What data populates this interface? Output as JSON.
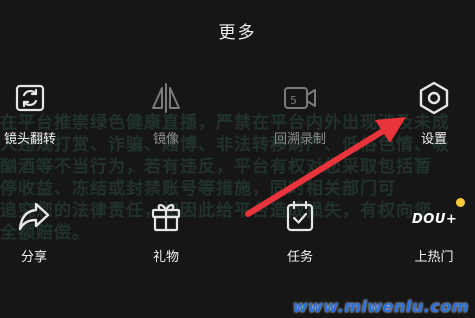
{
  "sheet": {
    "title": "更多"
  },
  "background_notice": {
    "lines": [
      "在平台推崇绿色健康直播，严禁在平台内外出现涉及未成",
      "人违规打赏、诈骗、赌博、非法转移财产、低俗色情、吸",
      "酗酒等不当行为，若有违反，平台有权对您采取包括暂",
      "停收益、冻结或封禁账号等措施，同时相关部门可",
      "追究您的法律责任，如因此给平台造成损失，有权向您",
      "全额赔偿。"
    ]
  },
  "row1": [
    {
      "label": "镜头翻转",
      "icon": "camera-flip-icon"
    },
    {
      "label": "镜像",
      "icon": "mirror-icon"
    },
    {
      "label": "回溯录制",
      "icon": "replay-record-icon"
    },
    {
      "label": "设置",
      "icon": "settings-icon"
    }
  ],
  "row2": [
    {
      "label": "分享",
      "icon": "share-icon"
    },
    {
      "label": "礼物",
      "icon": "gift-icon"
    },
    {
      "label": "任务",
      "icon": "task-icon"
    },
    {
      "label": "上热门",
      "icon": "dou-plus-icon",
      "badge": "DOU+"
    }
  ],
  "watermark": "www.miwenlu.com",
  "colors": {
    "arrow": "#e8343a",
    "badge_dot": "#ffc93c",
    "watermark": "#2a6fd8"
  }
}
